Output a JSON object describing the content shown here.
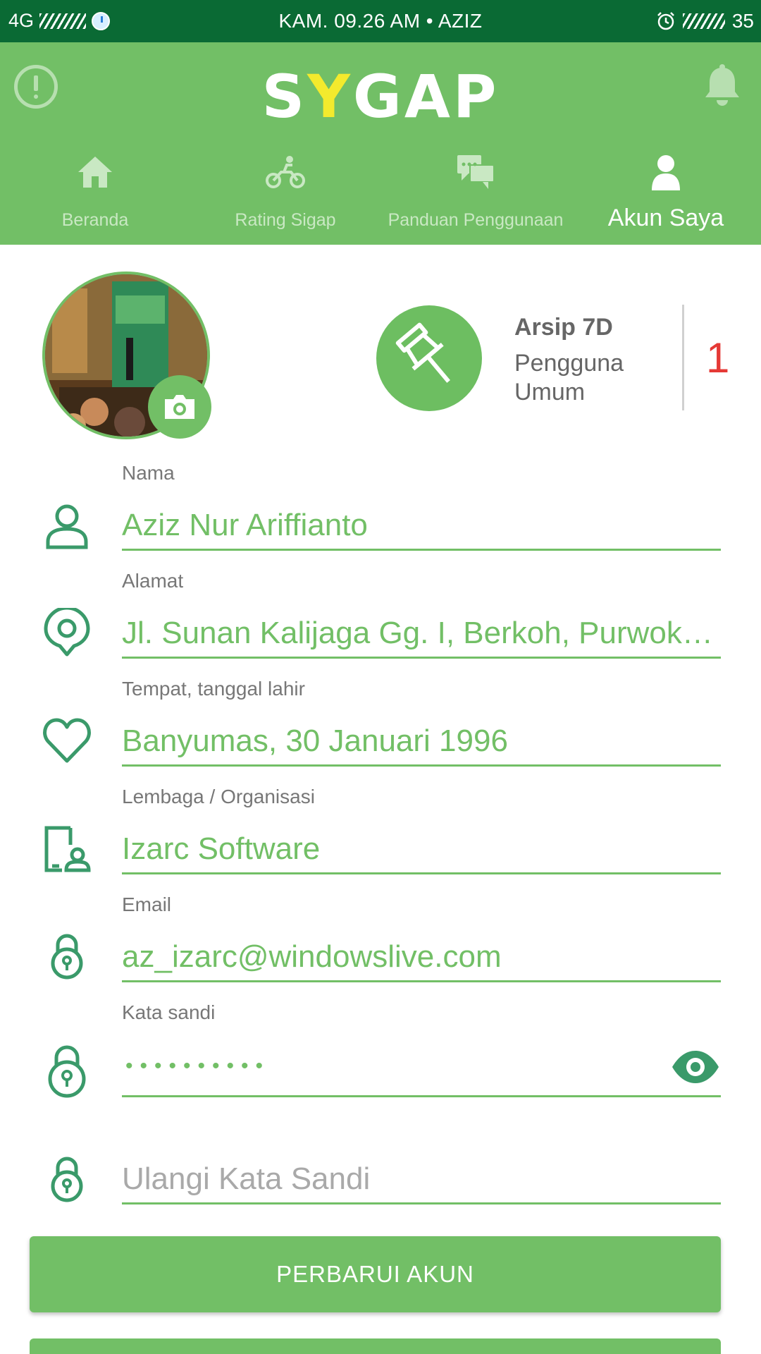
{
  "status_bar": {
    "network": "4G",
    "center": "KAM. 09.26 AM • AZIZ",
    "battery": "35"
  },
  "header": {
    "logo_left": "S",
    "logo_y": "Y",
    "logo_right": "GAP",
    "icons": [
      "alert-icon",
      "bell-icon"
    ]
  },
  "tabs": [
    {
      "label": "Beranda",
      "icon": "home-icon"
    },
    {
      "label": "Rating Sigap",
      "icon": "motorbike-icon"
    },
    {
      "label": "Panduan Penggunaan",
      "icon": "chat-icon"
    },
    {
      "label": "Akun Saya",
      "icon": "user-icon",
      "active": true
    }
  ],
  "profile": {
    "badge_title": "Arsip 7D",
    "badge_subtitle": "Pengguna Umum",
    "badge_count": "1"
  },
  "form": {
    "name_label": "Nama",
    "name_value": "Aziz Nur Ariffianto",
    "address_label": "Alamat",
    "address_value": "Jl. Sunan Kalijaga Gg. I, Berkoh, Purwokerto",
    "birth_label": "Tempat, tanggal lahir",
    "birth_value": "Banyumas, 30 Januari 1996",
    "org_label": "Lembaga / Organisasi",
    "org_value": "Izarc Software",
    "email_label": "Email",
    "email_value": "az_izarc@windowslive.com",
    "password_label": "Kata sandi",
    "password_mask": "••••••••••",
    "repeat_placeholder": "Ulangi Kata Sandi"
  },
  "buttons": {
    "update": "PERBARUI AKUN"
  },
  "colors": {
    "primary": "#72bf66",
    "status_bar": "#0a6a34",
    "icon_dark": "#3a9a6a",
    "count": "#e53935"
  }
}
